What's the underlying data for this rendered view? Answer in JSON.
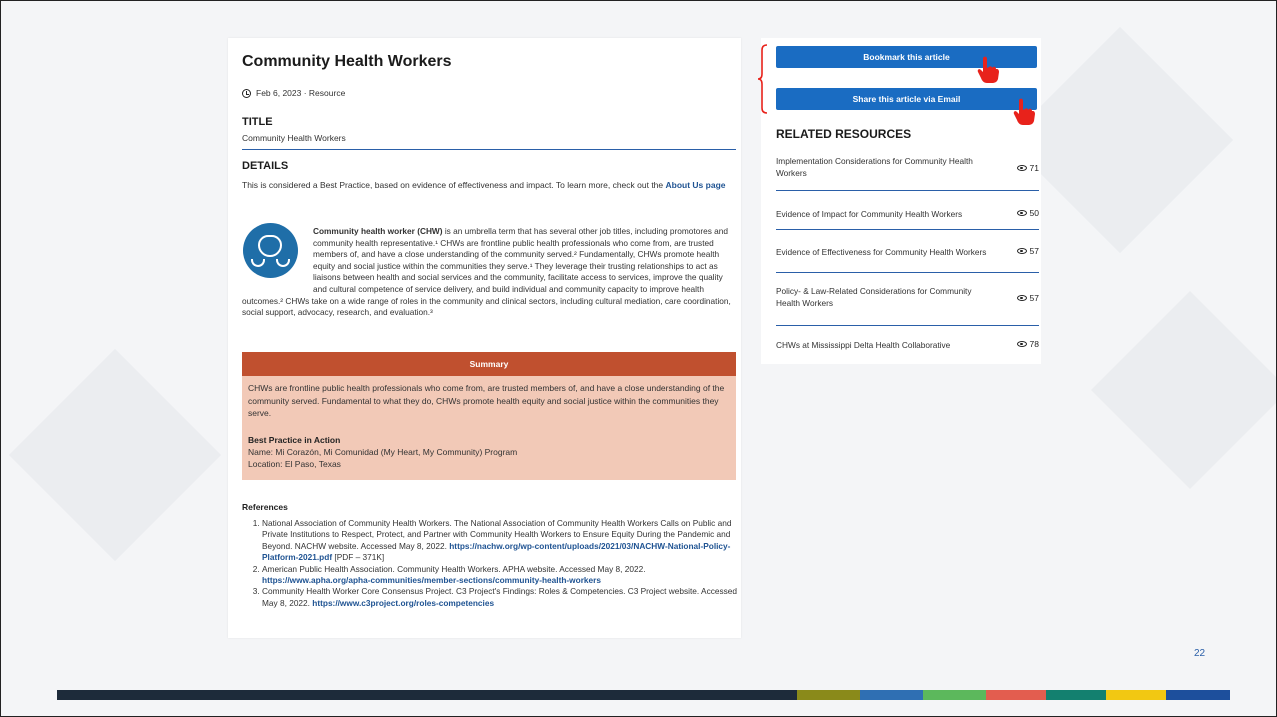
{
  "article": {
    "title": "Community Health Workers",
    "meta": "Feb 6, 2023 · Resource",
    "title_heading": "TITLE",
    "title_value": "Community Health Workers",
    "details_heading": "DETAILS",
    "details_text": "This is considered a Best Practice, based on evidence of effectiveness and impact. To learn more, check out the",
    "details_link": "About Us page",
    "body_lead": "Community health worker (CHW)",
    "body_text": " is an umbrella term that has several other job titles, including promotores and community health representative.¹ CHWs are frontline public health professionals who come from, are trusted members of, and have a close understanding of the community served.² Fundamentally, CHWs promote health equity and social justice within the communities they serve.¹ They leverage their trusting relationships to act as liaisons between health and social services and the community, facilitate access to services, improve the quality and cultural competence of service delivery, and build individual and community capacity to improve health outcomes.² CHWs take on a wide range of roles in the community and clinical sectors, including cultural mediation, care coordination, social support, advocacy, research, and evaluation.³",
    "summary_heading": "Summary",
    "summary_text": "CHWs are frontline public health professionals who come from, are trusted members of, and have a close understanding of the community served. Fundamental to what they do, CHWs promote health equity and social justice within the communities they serve.",
    "bp_heading": "Best Practice in Action",
    "bp_name": "Name: Mi Corazón, Mi Comunidad (My Heart, My Community) Program",
    "bp_location": "Location: El Paso, Texas",
    "references_heading": "References",
    "references": [
      {
        "text": "National Association of Community Health Workers. The National Association of Community Health Workers Calls on Public and Private Institutions to Respect, Protect, and Partner with Community Health Workers to Ensure Equity During the Pandemic and Beyond. NACHW website. Accessed May 8, 2022. ",
        "link": "https://nachw.org/wp-content/uploads/2021/03/NACHW-National-Policy-Platform-2021.pdf",
        "suffix": " [PDF – 371K]"
      },
      {
        "text": "American Public Health Association. Community Health Workers. APHA website. Accessed May 8, 2022. ",
        "link": "https://www.apha.org/apha-communities/member-sections/community-health-workers",
        "suffix": ""
      },
      {
        "text": "Community Health Worker Core Consensus Project. C3 Project's Findings: Roles & Competencies. C3 Project website. Accessed May 8, 2022. ",
        "link": "https://www.c3project.org/roles-competencies",
        "suffix": ""
      }
    ]
  },
  "sidebar": {
    "bookmark_label": "Bookmark this article",
    "share_label": "Share this article via Email",
    "related_heading": "RELATED RESOURCES",
    "related": [
      {
        "label": "Implementation Considerations for Community Health Workers",
        "views": "71"
      },
      {
        "label": "Evidence of Impact for Community Health Workers",
        "views": "50"
      },
      {
        "label": "Evidence of Effectiveness for Community Health Workers",
        "views": "57"
      },
      {
        "label": "Policy- & Law-Related Considerations for Community Health Workers",
        "views": "57"
      },
      {
        "label": "CHWs at Mississippi Delta Health Collaborative",
        "views": "78"
      }
    ]
  },
  "slide": {
    "page_number": "22",
    "colors": {
      "accent_blue": "#1a6cc2",
      "summary_header": "#c0502f",
      "summary_body": "#f2c9b7",
      "cursor_red": "#e8221b"
    },
    "bar_colors": [
      "#1d2b3a",
      "#8a8a1a",
      "#2f6fb3",
      "#5cb85c",
      "#e35d4f",
      "#13806f",
      "#f2c812",
      "#1d4f9c"
    ]
  }
}
